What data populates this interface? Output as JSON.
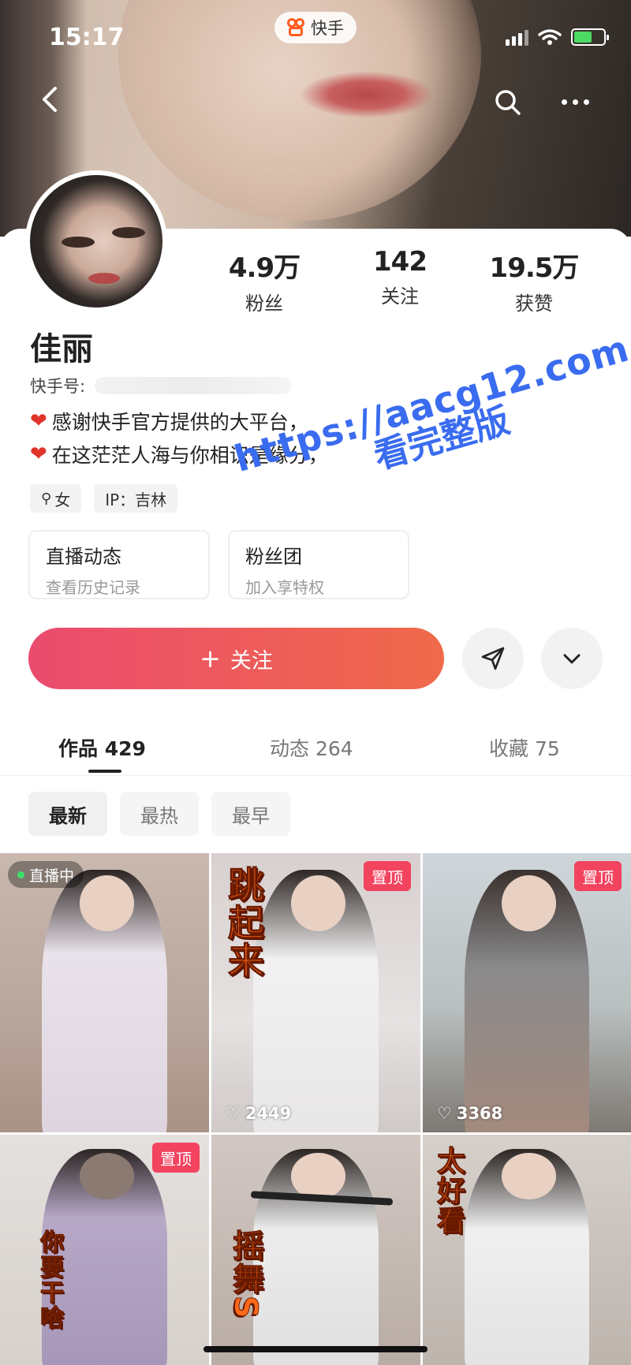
{
  "status_bar": {
    "time": "15:17",
    "app_name": "快手"
  },
  "profile": {
    "name": "佳丽",
    "kuaishou_id_label": "快手号:",
    "bio": [
      {
        "emoji": "❤️",
        "text": "感谢快手官方提供的大平台，"
      },
      {
        "emoji": "❤️",
        "text": "在这茫茫人海与你相识是缘分，"
      }
    ],
    "tags": {
      "gender": "女",
      "ip": "IP：吉林"
    }
  },
  "stats": [
    {
      "value": "4.9万",
      "label": "粉丝"
    },
    {
      "value": "142",
      "label": "关注"
    },
    {
      "value": "19.5万",
      "label": "获赞"
    }
  ],
  "entries": [
    {
      "title": "直播动态",
      "subtitle": "查看历史记录"
    },
    {
      "title": "粉丝团",
      "subtitle": "加入享特权"
    }
  ],
  "actions": {
    "follow_label": "关注",
    "follow_plus": "+"
  },
  "tabs": [
    {
      "label": "作品 429",
      "active": true
    },
    {
      "label": "动态 264",
      "active": false
    },
    {
      "label": "收藏 75",
      "active": false
    }
  ],
  "filters": [
    "最新",
    "最热",
    "最早"
  ],
  "videos": [
    {
      "badge_live": "直播中"
    },
    {
      "badge_pin": "置顶",
      "overlay_text": "跳起来",
      "likes": "2449"
    },
    {
      "badge_pin": "置顶",
      "likes": "3368"
    },
    {
      "badge_pin": "置顶",
      "overlay_text": "你要干啥"
    },
    {
      "overlay_text": "摇舞S"
    },
    {
      "overlay_text": "太好看"
    }
  ],
  "watermark": {
    "line1": "https://aacg12.com",
    "line2": "看完整版"
  },
  "colors": {
    "accent_start": "#ea4b6e",
    "accent_end": "#f06a4a",
    "pin": "#f2435f",
    "watermark": "#3a6cf0"
  }
}
